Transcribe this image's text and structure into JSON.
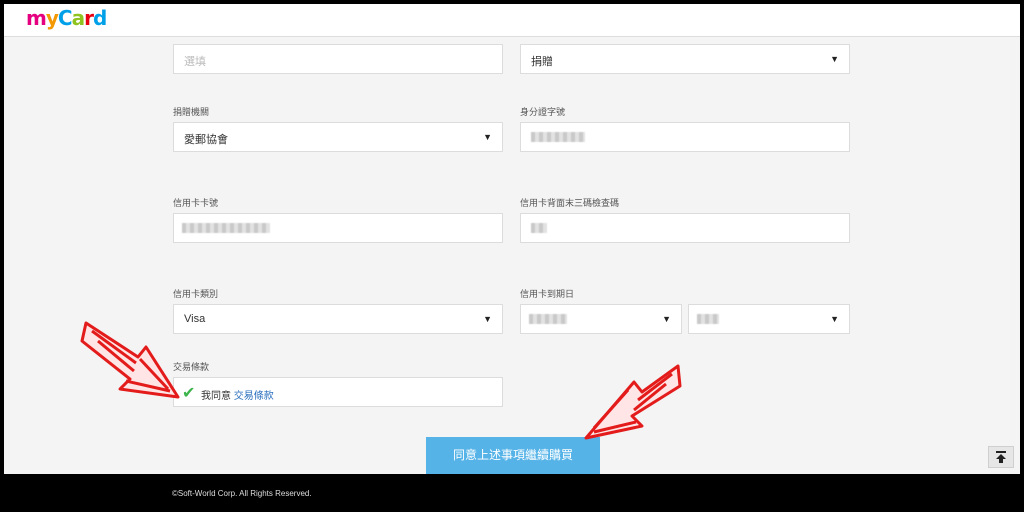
{
  "header": {
    "logo_text": "myCard"
  },
  "form": {
    "field_top_left_placeholder": "選填",
    "field_top_right_value": "捐贈",
    "donation_org": {
      "label": "捐贈機關",
      "value": "愛郵協會"
    },
    "id_number": {
      "label": "身分證字號"
    },
    "card_number": {
      "label": "信用卡卡號"
    },
    "cvv": {
      "label": "信用卡背面末三碼檢查碼"
    },
    "card_type": {
      "label": "信用卡類別",
      "value": "Visa"
    },
    "expiry": {
      "label": "信用卡到期日"
    },
    "terms": {
      "label": "交易條款",
      "agree_text": "我同意",
      "link_text": "交易條款"
    }
  },
  "submit_label": "同意上述事項繼續購買",
  "footer": {
    "copyright": "©Soft-World Corp. All Rights Reserved."
  },
  "icons": {
    "caret": "▼",
    "check": "✔",
    "back_to_top": "back-to-top-icon"
  },
  "colors": {
    "accent": "#55b3e8",
    "check": "#3cb44b",
    "link": "#2a6ebd",
    "annotation": "#e31b1b"
  }
}
